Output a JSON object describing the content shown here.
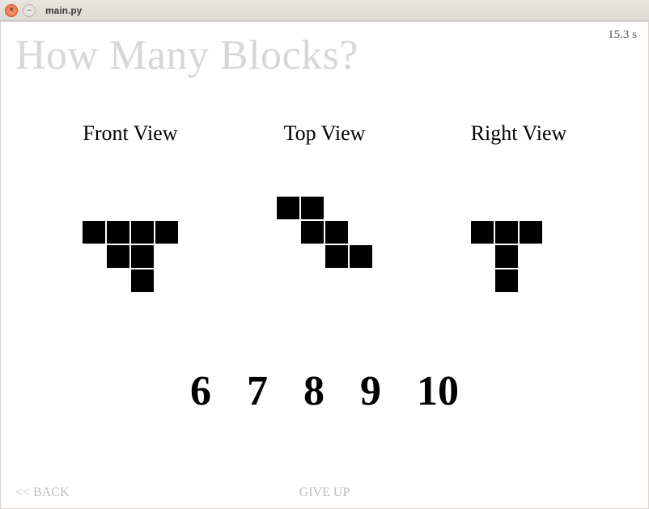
{
  "window": {
    "title": "main.py"
  },
  "question_title": "How Many Blocks?",
  "timer": "15.3 s",
  "views": [
    {
      "label": "Front View",
      "grid": {
        "cols": 6,
        "rows": 5
      },
      "blocks": [
        [
          1,
          1
        ],
        [
          2,
          1
        ],
        [
          3,
          1
        ],
        [
          4,
          1
        ],
        [
          2,
          2
        ],
        [
          3,
          2
        ],
        [
          3,
          3
        ]
      ]
    },
    {
      "label": "Top View",
      "grid": {
        "cols": 6,
        "rows": 5
      },
      "blocks": [
        [
          1,
          0
        ],
        [
          2,
          0
        ],
        [
          2,
          1
        ],
        [
          3,
          1
        ],
        [
          3,
          2
        ],
        [
          4,
          2
        ]
      ]
    },
    {
      "label": "Right View",
      "grid": {
        "cols": 6,
        "rows": 5
      },
      "blocks": [
        [
          1,
          1
        ],
        [
          2,
          1
        ],
        [
          3,
          1
        ],
        [
          2,
          2
        ],
        [
          2,
          3
        ]
      ]
    }
  ],
  "answers": [
    "6",
    "7",
    "8",
    "9",
    "10"
  ],
  "footer": {
    "back": "<< BACK",
    "giveup": "GIVE UP"
  },
  "cell_size": 30
}
